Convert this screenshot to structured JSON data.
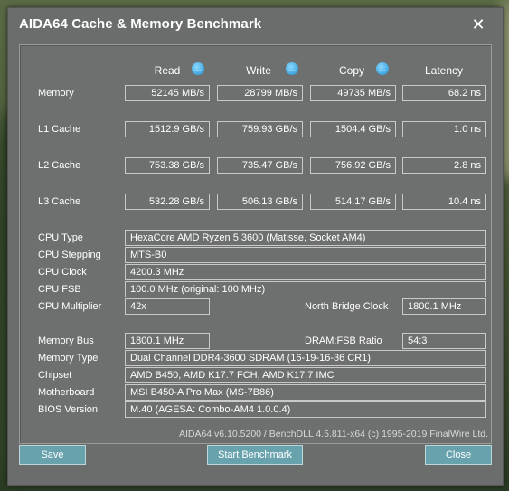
{
  "window": {
    "title": "AIDA64 Cache & Memory Benchmark"
  },
  "columns": [
    "Read",
    "Write",
    "Copy",
    "Latency"
  ],
  "bench_rows": [
    {
      "label": "Memory",
      "read": "52145 MB/s",
      "write": "28799 MB/s",
      "copy": "49735 MB/s",
      "latency": "68.2 ns"
    },
    {
      "label": "L1 Cache",
      "read": "1512.9 GB/s",
      "write": "759.93 GB/s",
      "copy": "1504.4 GB/s",
      "latency": "1.0 ns"
    },
    {
      "label": "L2 Cache",
      "read": "753.38 GB/s",
      "write": "735.47 GB/s",
      "copy": "756.92 GB/s",
      "latency": "2.8 ns"
    },
    {
      "label": "L3 Cache",
      "read": "532.28 GB/s",
      "write": "506.13 GB/s",
      "copy": "514.17 GB/s",
      "latency": "10.4 ns"
    }
  ],
  "cpu": {
    "type_label": "CPU Type",
    "type": "HexaCore AMD Ryzen 5 3600  (Matisse, Socket AM4)",
    "stepping_label": "CPU Stepping",
    "stepping": "MTS-B0",
    "clock_label": "CPU Clock",
    "clock": "4200.3 MHz",
    "fsb_label": "CPU FSB",
    "fsb": "100.0 MHz  (original: 100 MHz)",
    "multiplier_label": "CPU Multiplier",
    "multiplier": "42x",
    "nb_clock_label": "North Bridge Clock",
    "nb_clock": "1800.1 MHz"
  },
  "memory": {
    "bus_label": "Memory Bus",
    "bus": "1800.1 MHz",
    "ratio_label": "DRAM:FSB Ratio",
    "ratio": "54:3",
    "type_label": "Memory Type",
    "type": "Dual Channel DDR4-3600 SDRAM  (16-19-16-36 CR1)",
    "chipset_label": "Chipset",
    "chipset": "AMD B450, AMD K17.7 FCH, AMD K17.7 IMC",
    "motherboard_label": "Motherboard",
    "motherboard": "MSI B450-A Pro Max (MS-7B86)",
    "bios_label": "BIOS Version",
    "bios": "M.40  (AGESA: Combo-AM4 1.0.0.4)"
  },
  "footer": "AIDA64 v6.10.5200 / BenchDLL 4.5.811-x64  (c) 1995-2019 FinalWire Ltd.",
  "buttons": {
    "save": "Save",
    "start": "Start Benchmark",
    "close": "Close"
  },
  "icons": {
    "close": "close-icon",
    "info": "info-icon"
  },
  "colors": {
    "button": "#68a3ad",
    "panel": "#6d706e",
    "info_icon": "#1f8ed0"
  }
}
